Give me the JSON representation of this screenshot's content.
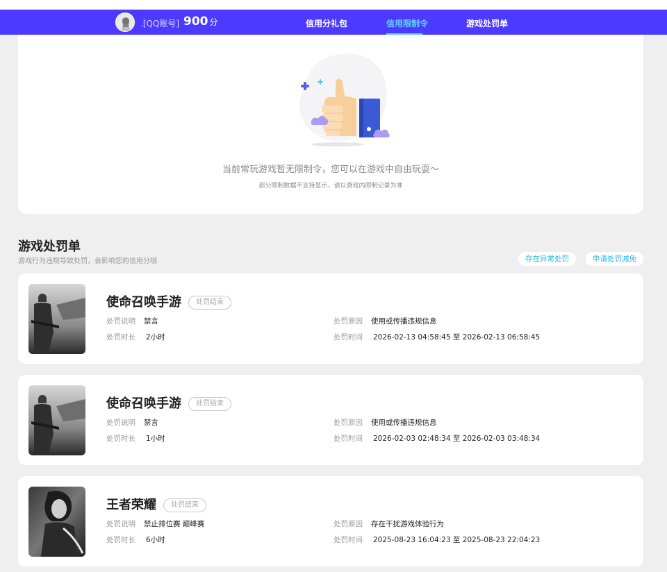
{
  "header": {
    "nickname": ".[QQ账号]",
    "score": "900",
    "score_unit": "分",
    "nav": [
      {
        "label": "信用分礼包"
      },
      {
        "label": "信用限制令"
      },
      {
        "label": "游戏处罚单"
      }
    ],
    "active_index": 1
  },
  "restrictions": {
    "empty_text": "当前常玩游戏暂无限制令，您可以在游戏中自由玩耍～",
    "note": "部分限制数据不支持显示，请以游戏内限制记录为准"
  },
  "penalties": {
    "title": "游戏处罚单",
    "subtitle": "游戏行为违规导致处罚，会影响您的信用分哦",
    "actions": [
      "存在异常处罚",
      "申请处罚减免"
    ],
    "labels": {
      "desc": "处罚说明",
      "duration": "处罚时长",
      "reason": "处罚原因",
      "time": "处罚时间"
    },
    "items": [
      {
        "game": "使命召唤手游",
        "status": "处罚结束",
        "desc": "禁言",
        "duration": "2小时",
        "reason": "使用或传播违规信息",
        "time": "2026-02-13 04:58:45 至 2026-02-13 06:58:45"
      },
      {
        "game": "使命召唤手游",
        "status": "处罚结束",
        "desc": "禁言",
        "duration": "1小时",
        "reason": "使用或传播违规信息",
        "time": "2026-02-03 02:48:34 至 2026-02-03 03:48:34"
      },
      {
        "game": "王者荣耀",
        "status": "处罚结束",
        "desc": "禁止排位赛 巅峰赛",
        "duration": "6小时",
        "reason": "存在干扰游戏体验行为",
        "time": "2025-08-23 16:04:23 至 2025-08-23 22:04:23"
      }
    ]
  },
  "colors": {
    "header_bg": "#4c3bff",
    "active_tab": "#5fd3ff",
    "link": "#2eb8e6",
    "page_bg": "#efefef"
  }
}
